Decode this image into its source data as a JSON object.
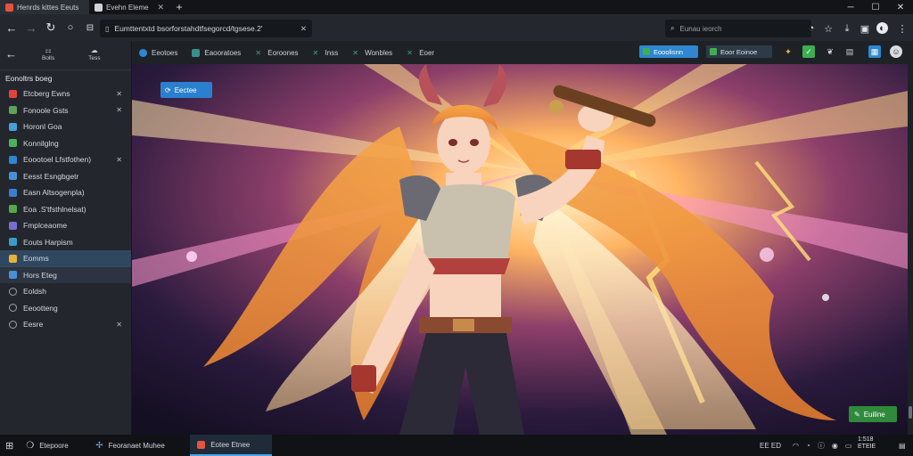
{
  "browser": {
    "tabs": [
      {
        "label": "Henrds kittes Eeuts",
        "favicon_color": "#e5533d"
      },
      {
        "label": "Evehn Eleme",
        "favicon_color": "#cfd3d8"
      }
    ],
    "new_tab_symbol": "+",
    "address": "Eumttentxtd bsorforstahdtfsegorcd/tgsese.2'",
    "search_placeholder": "Eunau ieorch"
  },
  "sidebar": {
    "top": [
      {
        "label": "Bolls",
        "icon": "grid-icon"
      },
      {
        "label": "Tess",
        "icon": "cloud-icon"
      }
    ],
    "heading": "Eonoltrs boeg",
    "items": [
      {
        "label": "Etcberg Ewns",
        "color": "#e0443a",
        "pinned": true
      },
      {
        "label": "Fonoole Gsts",
        "color": "#5fa35a",
        "pinned": true
      },
      {
        "label": "Horonl Goa",
        "color": "#47a0d8",
        "pinned": false
      },
      {
        "label": "Konnilglng",
        "color": "#4bb35b",
        "pinned": false
      },
      {
        "label": "Eoootoel Lfstfothen)",
        "color": "#2e87d0",
        "pinned": true
      },
      {
        "label": "Eesst Esngbgetr",
        "color": "#4a8fd8",
        "pinned": false
      },
      {
        "label": "Easn Altsogenpla)",
        "color": "#3b7fd0",
        "pinned": false
      },
      {
        "label": "Eoa .S'tfsthlnelsat)",
        "color": "#55aa44",
        "pinned": false
      },
      {
        "label": "Fmplceaome",
        "color": "#7a6cd0",
        "pinned": false
      },
      {
        "label": "Eouts Harpism",
        "color": "#3a9cc8",
        "pinned": false
      },
      {
        "label": "Eomms",
        "color": "#e7b23a",
        "pinned": false
      },
      {
        "label": "Hors Eteg",
        "color": "#4a8fd8",
        "pinned": false
      },
      {
        "label": "Eoldsh",
        "color": "#9aa1aa",
        "pinned": false
      },
      {
        "label": "Eeootteng",
        "color": "#9aa1aa",
        "pinned": false
      },
      {
        "label": "Eesre",
        "color": "#9aa1aa",
        "pinned": true
      }
    ]
  },
  "contentbar": {
    "tabs": [
      {
        "label": "Eeotoes",
        "color": "#2e87d0"
      },
      {
        "label": "Eaooratoes",
        "color": "#3a8f8a"
      },
      {
        "label": "Eoroones",
        "color": "#3aa07a"
      },
      {
        "label": "Inss",
        "color": "#3aa07a"
      },
      {
        "label": "Wonbles",
        "color": "#3aa07a"
      },
      {
        "label": "Eoer",
        "color": "#3aa07a"
      }
    ],
    "actions": [
      {
        "label": "Eooolisnn",
        "bg": "#2e87d0"
      },
      {
        "label": "Eoor Eoinoe",
        "bg": "#2d3a48"
      }
    ]
  },
  "canvas": {
    "source_button": "Eectee",
    "edit_button": "Euiline"
  },
  "taskbar": {
    "items": [
      {
        "label": "Etepoore",
        "icon": "chat-icon",
        "active": false
      },
      {
        "label": "Feoranaet Muhee",
        "icon": "pinwheel-icon",
        "active": false
      },
      {
        "label": "Eotee Etnee",
        "icon": "app-icon",
        "active": true
      }
    ],
    "tray_text": "EE ED",
    "clock_time": "1:518",
    "clock_date": "ETEIE"
  },
  "colors": {
    "accent": "#2e87d0",
    "hair": "#f0a24a",
    "glow": "#ffcf66"
  }
}
